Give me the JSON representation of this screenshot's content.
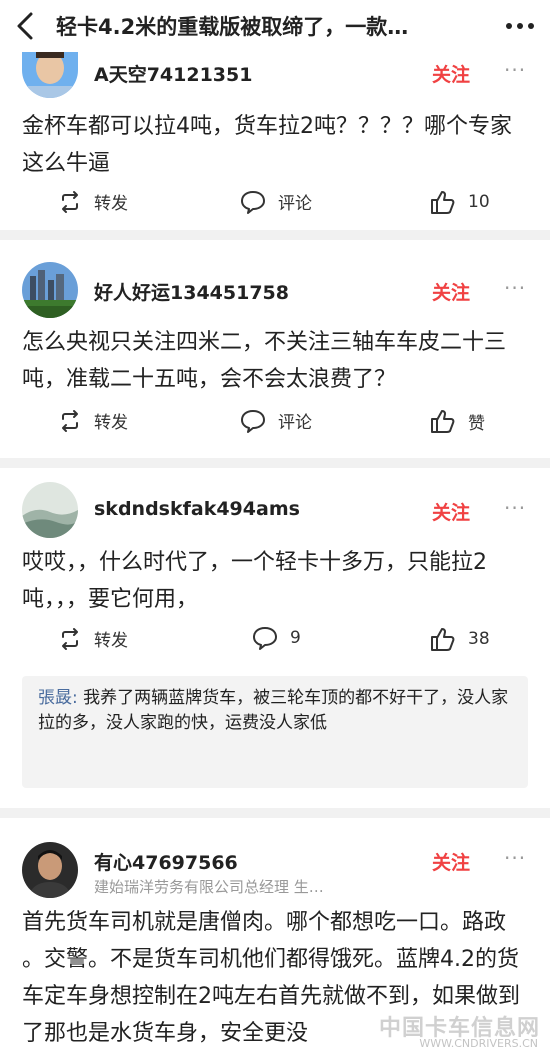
{
  "header": {
    "title": "轻卡4.2米的重载版被取缔了，一款…"
  },
  "comments": [
    {
      "user": "A天空74121351",
      "follow": "关注",
      "text": "金杯车都可以拉4吨，货车拉2吨？？？？哪个专家这么牛逼",
      "actions": {
        "repost": "转发",
        "comment": "评论",
        "like": "10"
      }
    },
    {
      "user": "好人好运134451758",
      "follow": "关注",
      "text": "怎么央视只关注四米二，不关注三轴车车皮二十三吨，准载二十五吨，会不会太浪费了？",
      "actions": {
        "repost": "转发",
        "comment": "评论",
        "like": "赞"
      }
    },
    {
      "user": "skdndskfak494ams",
      "follow": "关注",
      "text": "哎哎，，什么时代了，一个轻卡十多万，只能拉2吨，，，要它何用，",
      "actions": {
        "repost": "转发",
        "comment": "9",
        "like": "38"
      },
      "reply": {
        "name": "張晸:",
        "text": " 我养了两辆蓝牌货车，被三轮车顶的都不好干了，没人家拉的多，没人家跑的快，运费没人家低"
      }
    },
    {
      "user": "有心47697566",
      "title": "建始瑞洋劳务有限公司总经理 生…",
      "follow": "关注",
      "text": "首先货车司机就是唐僧肉。哪个都想吃一口。路政 。交警。不是货车司机他们都得饿死。蓝牌4.2的货车定车身想控制在2吨左右首先就做不到，如果做到了那也是水货车身，安全更没"
    }
  ],
  "watermark": {
    "main": "中国卡车信息网",
    "url": "WWW.CNDRIVERS.CN"
  },
  "colors": {
    "accent": "#f04142",
    "reply_name": "#4a6c9e",
    "separator": "#f1f1f1"
  }
}
